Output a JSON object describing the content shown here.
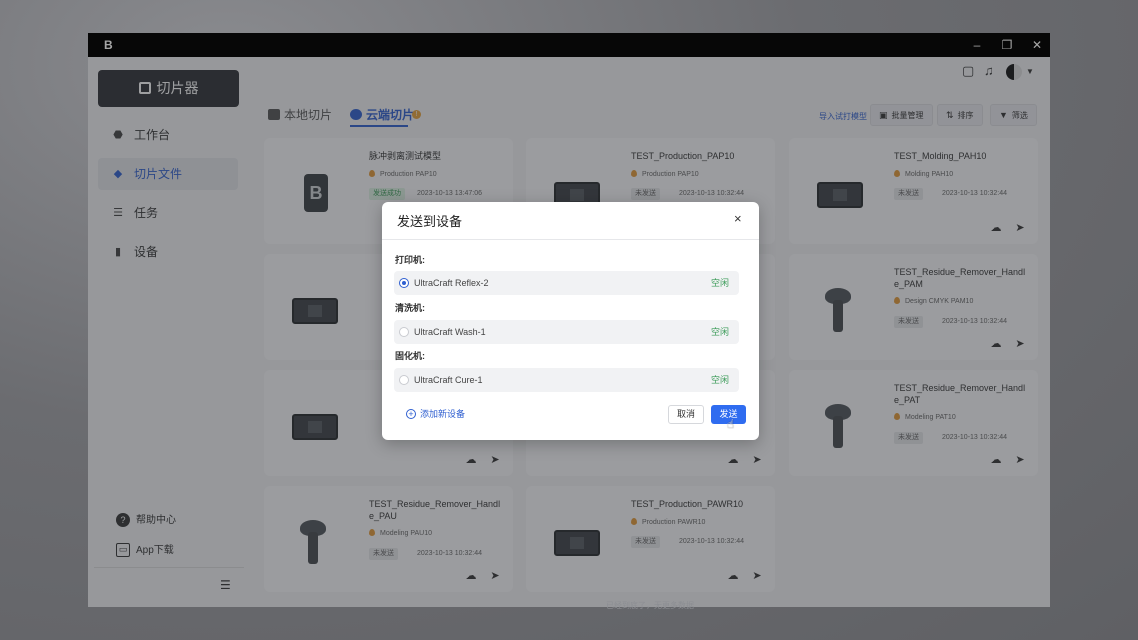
{
  "window": {
    "logo_glyph": "B",
    "controls": {
      "minimize": "–",
      "restore": "❐",
      "close": "✕"
    }
  },
  "sidebar": {
    "slicer_button": "切片器",
    "items": [
      {
        "label": "工作台",
        "icon": "workbench-icon"
      },
      {
        "label": "切片文件",
        "icon": "layers-icon",
        "active": true
      },
      {
        "label": "任务",
        "icon": "task-list-icon"
      },
      {
        "label": "设备",
        "icon": "device-icon"
      }
    ],
    "help": "帮助中心",
    "app_download": "App下载"
  },
  "header": {
    "feedback_icon": "feedback-icon",
    "bell_icon": "bell-icon"
  },
  "tabs": [
    {
      "label": "本地切片",
      "active": false
    },
    {
      "label": "云端切片",
      "active": true
    }
  ],
  "toolbar": {
    "import_link": "导入试打模型",
    "batch_manage": "批量管理",
    "sort": "排序",
    "filter": "筛选"
  },
  "cards": [
    {
      "title": "脉冲剥离测试模型",
      "material": "Production PAP10",
      "status": "发送成功",
      "status_ok": true,
      "date": "2023-10-13 13:47:06",
      "thumb": "logo"
    },
    {
      "title": "TEST_Production_PAP10",
      "material": "Production PAP10",
      "status": "未发送",
      "status_ok": false,
      "date": "2023-10-13 10:32:44",
      "thumb": "plate"
    },
    {
      "title": "TEST_Molding_PAH10",
      "material": "Molding PAH10",
      "status": "未发送",
      "status_ok": false,
      "date": "2023-10-13 10:32:44",
      "thumb": "plate"
    },
    {
      "title": "TEST_Residue_Remover_Handle_PAM",
      "material": "Design CMYK PAM10",
      "status": "未发送",
      "status_ok": false,
      "date": "2023-10-13 10:32:44",
      "thumb": "knob"
    },
    {
      "title": "TEST_Residue_Remover_Handle_PAT",
      "material": "Modeling PAT10",
      "status": "未发送",
      "status_ok": false,
      "date": "2023-10-13 10:32:44",
      "thumb": "knob"
    },
    {
      "title": "TEST_Residue_Remover_Handle_PAU",
      "material": "Modeling PAU10",
      "status": "未发送",
      "status_ok": false,
      "date": "2023-10-13 10:32:44",
      "thumb": "knob"
    },
    {
      "title": "TEST_Production_PAWR10",
      "material": "Production PAWR10",
      "status": "未发送",
      "status_ok": false,
      "date": "2023-10-13 10:32:44",
      "thumb": "plate"
    }
  ],
  "modal": {
    "title": "发送到设备",
    "close": "×",
    "sections": [
      {
        "label": "打印机:",
        "device": "UltraCraft Reflex-2",
        "status": "空闲",
        "selected": true
      },
      {
        "label": "清洗机:",
        "device": "UltraCraft Wash-1",
        "status": "空闲",
        "selected": false
      },
      {
        "label": "固化机:",
        "device": "UltraCraft Cure-1",
        "status": "空闲",
        "selected": false
      }
    ],
    "add_device": "添加新设备",
    "cancel": "取消",
    "send": "发送"
  },
  "footer_hint": "已经到底了，无更多数据",
  "colors": {
    "accent": "#2f6cf0",
    "success": "#3a9b57",
    "material_drop": "#e39a38",
    "sidebar_button": "#2f3136"
  }
}
